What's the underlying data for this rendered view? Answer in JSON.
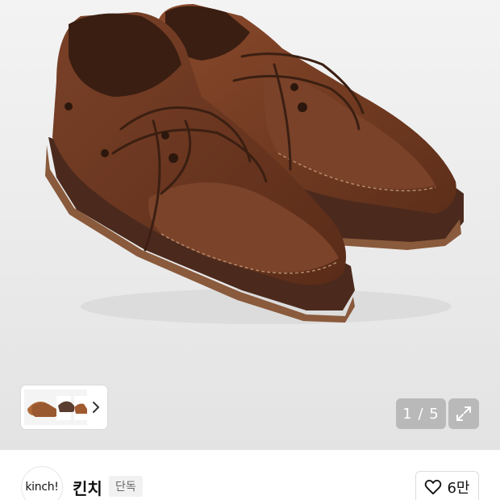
{
  "gallery": {
    "counter": "1 / 5",
    "thumbnail_icon": "shoe-thumbnails",
    "next_icon": "chevron-right-icon",
    "expand_icon": "expand-icon"
  },
  "brand": {
    "logo_text": "kinch!",
    "name": "킨치",
    "badge": "단독"
  },
  "like": {
    "icon": "heart-icon",
    "count": "6만"
  }
}
